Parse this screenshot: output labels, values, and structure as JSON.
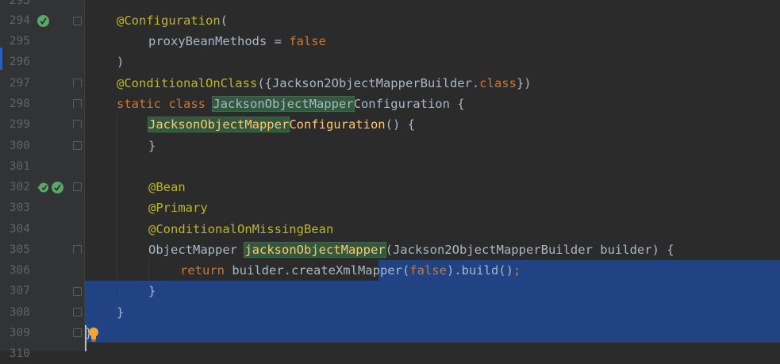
{
  "editor": {
    "language": "Java",
    "colors": {
      "background": "#2b2b2b",
      "gutter": "#313335",
      "selection": "#214283",
      "keyword": "#cc7832",
      "annotation": "#bbb529",
      "highlight": "#32593d"
    },
    "line_numbers": [
      "293",
      "294",
      "295",
      "296",
      "297",
      "298",
      "299",
      "300",
      "301",
      "302",
      "303",
      "304",
      "305",
      "306",
      "307",
      "308",
      "309",
      "310"
    ],
    "gutter_icons": {
      "line_294": "bean-configuration-icon",
      "line_302_a": "navigate-to-bean-icon",
      "line_302_b": "bean-definition-icon"
    },
    "code": {
      "l294_ann": "@Configuration",
      "l294_paren": "(",
      "l295_name": "proxyBeanMethods",
      "l295_eq": " = ",
      "l295_val": "false",
      "l296": ")",
      "l297_ann": "@ConditionalOnClass",
      "l297_rest_a": "({Jackson2ObjectMapperBuilder.",
      "l297_class": "class",
      "l297_rest_b": "})",
      "l298_kw": "static class ",
      "l298_hl": "JacksonObjectMapper",
      "l298_rest": "Configuration {",
      "l299_hl": "JacksonObjectMapper",
      "l299_rest": "Configuration",
      "l299_tail": "() {",
      "l300": "}",
      "l302": "@Bean",
      "l303": "@Primary",
      "l304": "@ConditionalOnMissingBean",
      "l305_type": "ObjectMapper ",
      "l305_hl": "jacksonObjectMapper",
      "l305_rest": "(Jackson2ObjectMapperBuilder builder) {",
      "l306_kw": "return",
      "l306_a": " builder.createXmlMapper(",
      "l306_false": "false",
      "l306_b": ").build()",
      "l306_semi": ";",
      "l307": "}",
      "l308": "}",
      "l309": "}"
    },
    "intention_icon": "lightbulb-icon"
  }
}
